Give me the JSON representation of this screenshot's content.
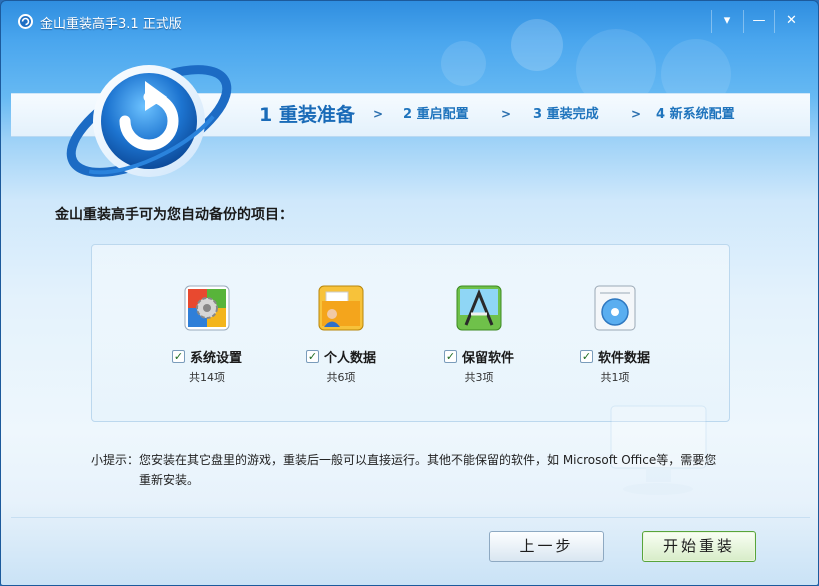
{
  "window": {
    "title": "金山重装高手3.1 正式版"
  },
  "window_buttons": {
    "menu": "▾",
    "minimize": "—",
    "close": "✕"
  },
  "steps": [
    {
      "label": "1 重装准备",
      "active": true
    },
    {
      "label": "2 重启配置",
      "active": false
    },
    {
      "label": "3 重装完成",
      "active": false
    },
    {
      "label": "4 新系统配置",
      "active": false
    }
  ],
  "step_separator": ">",
  "prompt": "金山重装高手可为您自动备份的项目：",
  "items": [
    {
      "label": "系统设置",
      "count": "共14项",
      "checked": true,
      "icon": "system-settings-icon"
    },
    {
      "label": "个人数据",
      "count": "共6项",
      "checked": true,
      "icon": "personal-data-icon"
    },
    {
      "label": "保留软件",
      "count": "共3项",
      "checked": true,
      "icon": "software-icon"
    },
    {
      "label": "软件数据",
      "count": "共1项",
      "checked": true,
      "icon": "software-data-icon"
    }
  ],
  "checkmark": "✓",
  "tip": {
    "line1": "小提示：您安装在其它盘里的游戏，重装后一般可以直接运行。其他不能保留的软件，如 Microsoft Office等，需要您",
    "line2": "重新安装。"
  },
  "buttons": {
    "prev": "上一步",
    "start": "开始重装"
  },
  "colors": {
    "accent": "#1a6bb8",
    "title_bar": "#2f8ee0",
    "start_border": "#58a43b"
  }
}
